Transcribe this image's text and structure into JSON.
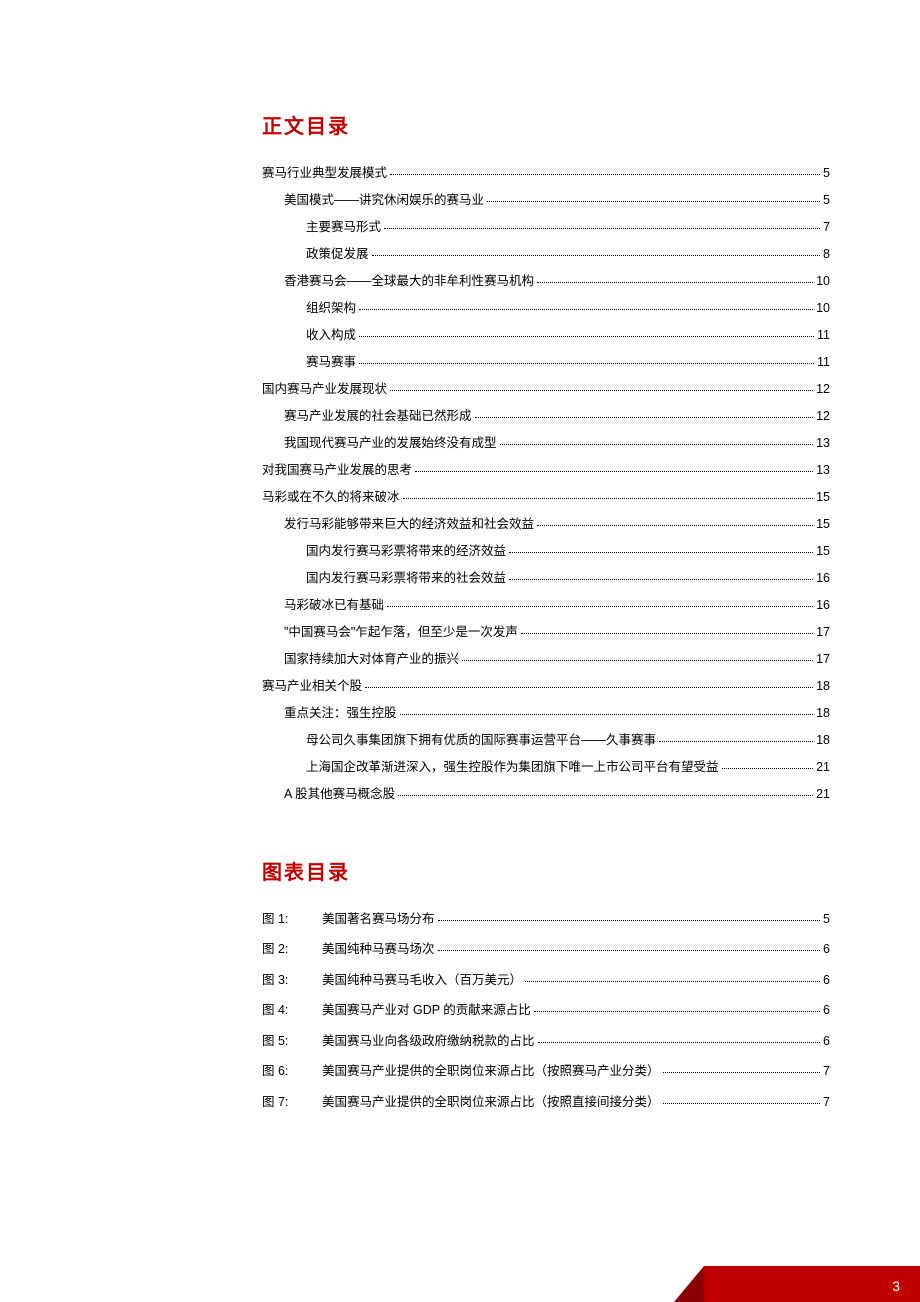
{
  "toc_title": "正文目录",
  "figures_title": "图表目录",
  "page_number": "3",
  "toc": [
    {
      "level": 1,
      "label": "赛马行业典型发展模式",
      "page": "5"
    },
    {
      "level": 2,
      "label": "美国模式——讲究休闲娱乐的赛马业",
      "page": "5"
    },
    {
      "level": 3,
      "label": "主要赛马形式",
      "page": "7"
    },
    {
      "level": 3,
      "label": "政策促发展",
      "page": "8"
    },
    {
      "level": 2,
      "label": "香港赛马会——全球最大的非牟利性赛马机构",
      "page": "10"
    },
    {
      "level": 3,
      "label": "组织架构",
      "page": "10"
    },
    {
      "level": 3,
      "label": "收入构成",
      "page": "11"
    },
    {
      "level": 3,
      "label": "赛马赛事",
      "page": "11"
    },
    {
      "level": 1,
      "label": "国内赛马产业发展现状",
      "page": "12"
    },
    {
      "level": 2,
      "label": "赛马产业发展的社会基础已然形成",
      "page": "12"
    },
    {
      "level": 2,
      "label": "我国现代赛马产业的发展始终没有成型",
      "page": "13"
    },
    {
      "level": 1,
      "label": "对我国赛马产业发展的思考",
      "page": "13"
    },
    {
      "level": 1,
      "label": "马彩或在不久的将来破冰",
      "page": "15"
    },
    {
      "level": 2,
      "label": "发行马彩能够带来巨大的经济效益和社会效益",
      "page": "15"
    },
    {
      "level": 3,
      "label": "国内发行赛马彩票将带来的经济效益",
      "page": "15"
    },
    {
      "level": 3,
      "label": "国内发行赛马彩票将带来的社会效益",
      "page": "16"
    },
    {
      "level": 2,
      "label": "马彩破冰已有基础",
      "page": "16"
    },
    {
      "level": 2,
      "label": "\"中国赛马会\"乍起乍落，但至少是一次发声",
      "page": "17"
    },
    {
      "level": 2,
      "label": "国家持续加大对体育产业的振兴",
      "page": "17"
    },
    {
      "level": 1,
      "label": "赛马产业相关个股",
      "page": "18"
    },
    {
      "level": 2,
      "label": "重点关注：强生控股",
      "page": "18"
    },
    {
      "level": 3,
      "label": "母公司久事集团旗下拥有优质的国际赛事运营平台——久事赛事",
      "page": "18"
    },
    {
      "level": 3,
      "label": "上海国企改革渐进深入，强生控股作为集团旗下唯一上市公司平台有望受益",
      "page": "21"
    },
    {
      "level": 2,
      "label": "A 股其他赛马概念股",
      "page": "21"
    }
  ],
  "figures": [
    {
      "prefix": "图 1:",
      "label": "美国著名赛马场分布",
      "page": "5"
    },
    {
      "prefix": "图 2:",
      "label": "美国纯种马赛马场次",
      "page": "6"
    },
    {
      "prefix": "图 3:",
      "label": "美国纯种马赛马毛收入（百万美元）",
      "page": "6"
    },
    {
      "prefix": "图 4:",
      "label": "美国赛马产业对 GDP 的贡献来源占比",
      "page": "6"
    },
    {
      "prefix": "图 5:",
      "label": "美国赛马业向各级政府缴纳税款的占比",
      "page": "6"
    },
    {
      "prefix": "图 6:",
      "label": "美国赛马产业提供的全职岗位来源占比（按照赛马产业分类）",
      "page": "7"
    },
    {
      "prefix": "图 7:",
      "label": "美国赛马产业提供的全职岗位来源占比（按照直接间接分类）",
      "page": "7"
    }
  ]
}
